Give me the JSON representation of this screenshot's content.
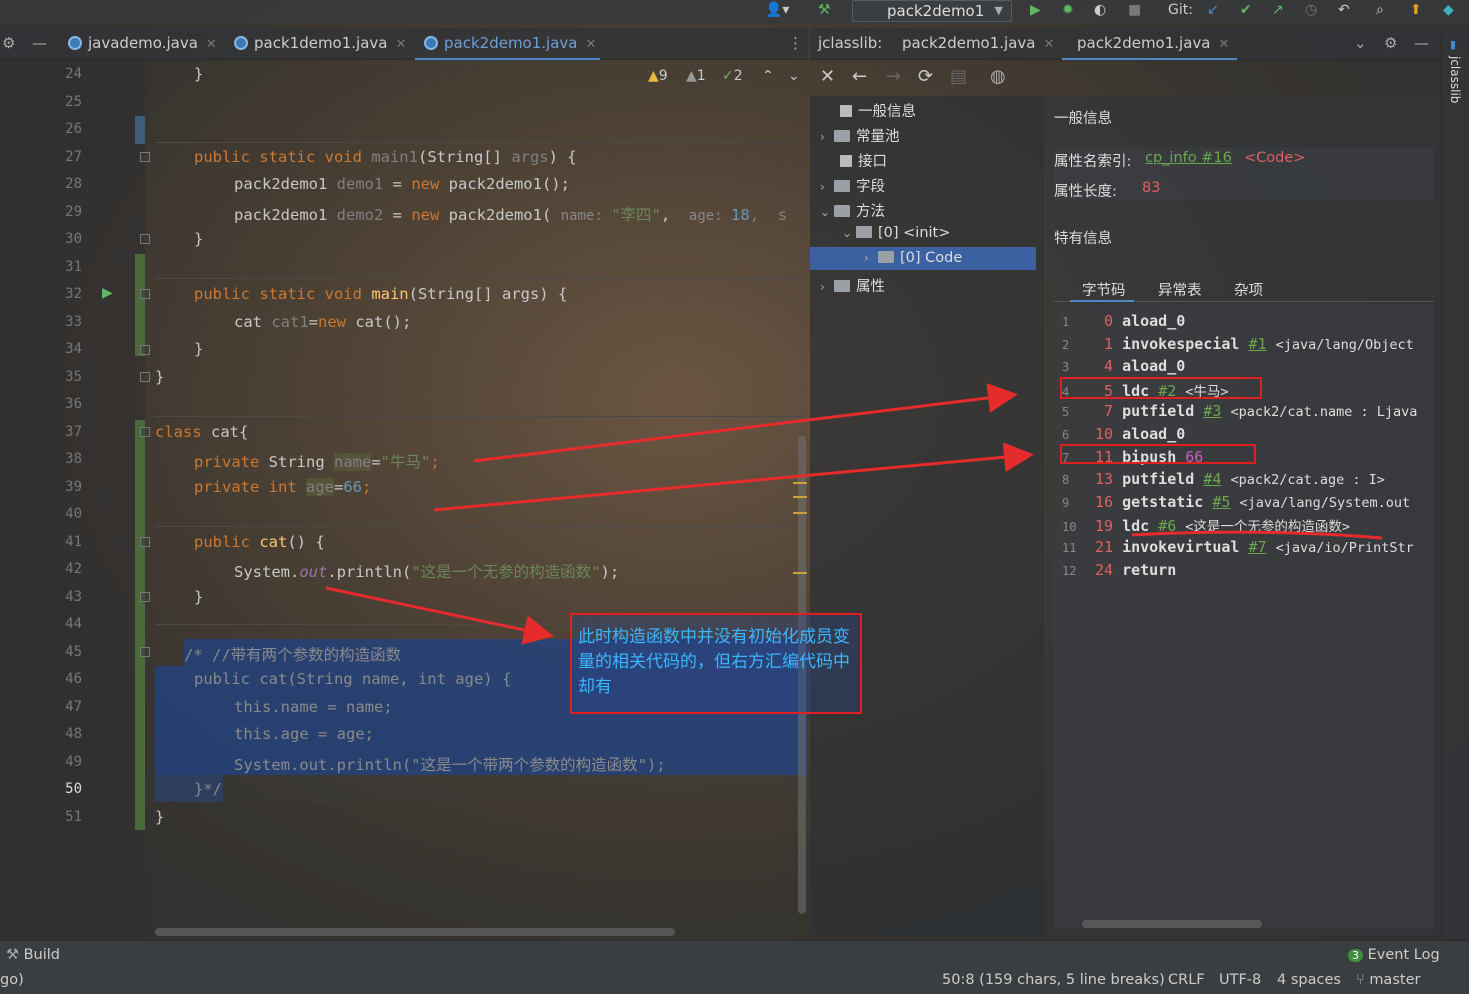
{
  "toolbar": {
    "project_selector": "pack2demo1",
    "git_label": "Git:"
  },
  "editor_tabs": [
    {
      "label": "javademo.java",
      "active": false
    },
    {
      "label": "pack1demo1.java",
      "active": false
    },
    {
      "label": "pack2demo1.java",
      "active": true
    }
  ],
  "inspections": {
    "warnings": "9",
    "weak_warnings": "1",
    "typos": "2"
  },
  "line_numbers": [
    "24",
    "25",
    "26",
    "27",
    "28",
    "29",
    "30",
    "31",
    "32",
    "33",
    "34",
    "35",
    "36",
    "37",
    "38",
    "39",
    "40",
    "41",
    "42",
    "43",
    "44",
    "45",
    "46",
    "47",
    "48",
    "49",
    "50",
    "51"
  ],
  "current_line": "50",
  "code": {
    "l24": "}",
    "l27_a": "public static void ",
    "l27_b": "main1",
    "l27_c": "(String[] ",
    "l27_d": "args",
    "l27_e": ") {",
    "l28_a": "pack2demo1 ",
    "l28_b": "demo1",
    "l28_c": " = ",
    "l28_d": "new ",
    "l28_e": "pack2demo1();",
    "l29_a": "pack2demo1 ",
    "l29_b": "demo2",
    "l29_c": " = ",
    "l29_d": "new ",
    "l29_e": "pack2demo1( ",
    "l29_f": "name: ",
    "l29_g": "\"李四\"",
    "l29_h": ",  ",
    "l29_i": "age: ",
    "l29_j": "18",
    "l29_k": ",  s",
    "l30": "}",
    "l32_a": "public static void ",
    "l32_b": "main",
    "l32_c": "(String[] args) {",
    "l33_a": "cat ",
    "l33_b": "cat1",
    "l33_c": "=",
    "l33_d": "new ",
    "l33_e": "cat();",
    "l34": "}",
    "l35": "}",
    "l37_a": "class ",
    "l37_b": "cat{",
    "l38_a": "private ",
    "l38_b": "String ",
    "l38_c": "name",
    "l38_d": "=",
    "l38_e": "\"牛马\"",
    "l38_f": ";",
    "l39_a": "private ",
    "l39_b": "int ",
    "l39_c": "age",
    "l39_d": "=",
    "l39_e": "66",
    "l39_f": ";",
    "l41_a": "public ",
    "l41_b": "cat",
    "l41_c": "() {",
    "l42_a": "System.",
    "l42_b": "out",
    "l42_c": ".println(",
    "l42_d": "\"这是一个无参的构造函数\"",
    "l42_e": ");",
    "l43": "}",
    "l45": "/* //带有两个参数的构造函数",
    "l46": "public cat(String name, int age) {",
    "l47": "this.name = name;",
    "l48": "this.age = age;",
    "l49": "System.out.println(\"这是一个带两个参数的构造函数\");",
    "l50": "}*/",
    "l51": "}"
  },
  "jclasslib": {
    "tabs": [
      {
        "label": "jclasslib:",
        "active": false
      },
      {
        "label": "pack2demo1.java",
        "active": false
      },
      {
        "label": "pack2demo1.java",
        "active": true
      }
    ],
    "tree": [
      {
        "label": "一般信息"
      },
      {
        "label": "常量池"
      },
      {
        "label": "接口"
      },
      {
        "label": "字段"
      },
      {
        "label": "方法"
      },
      {
        "label": "[0] <init>"
      },
      {
        "label": "[0] Code"
      },
      {
        "label": "属性"
      }
    ],
    "info_title": "一般信息",
    "attr_name_label": "属性名索引:",
    "attr_name_ref": "cp_info #16",
    "attr_name_value": "<Code>",
    "attr_len_label": "属性长度:",
    "attr_len_value": "83",
    "specific_title": "特有信息",
    "bytecode_tabs": [
      "字节码",
      "异常表",
      "杂项"
    ],
    "bytecode": [
      {
        "n": "1",
        "off": "0",
        "op": "aload_0",
        "ref": "",
        "arg": ""
      },
      {
        "n": "2",
        "off": "1",
        "op": "invokespecial",
        "ref": "#1",
        "arg": "<java/lang/Object"
      },
      {
        "n": "3",
        "off": "4",
        "op": "aload_0",
        "ref": "",
        "arg": ""
      },
      {
        "n": "4",
        "off": "5",
        "op": "ldc",
        "ref": "#2",
        "arg": "<牛马>"
      },
      {
        "n": "5",
        "off": "7",
        "op": "putfield",
        "ref": "#3",
        "arg": "<pack2/cat.name : Ljava"
      },
      {
        "n": "6",
        "off": "10",
        "op": "aload_0",
        "ref": "",
        "arg": ""
      },
      {
        "n": "7",
        "off": "11",
        "op": "bipush",
        "ref": "",
        "arg": "66"
      },
      {
        "n": "8",
        "off": "13",
        "op": "putfield",
        "ref": "#4",
        "arg": "<pack2/cat.age : I>"
      },
      {
        "n": "9",
        "off": "16",
        "op": "getstatic",
        "ref": "#5",
        "arg": "<java/lang/System.out"
      },
      {
        "n": "10",
        "off": "19",
        "op": "ldc",
        "ref": "#6",
        "arg": "<这是一个无参的构造函数>"
      },
      {
        "n": "11",
        "off": "21",
        "op": "invokevirtual",
        "ref": "#7",
        "arg": "<java/io/PrintStr"
      },
      {
        "n": "12",
        "off": "24",
        "op": "return",
        "ref": "",
        "arg": ""
      }
    ],
    "side_label": "jclasslib"
  },
  "annotation": "此时构造函数中并没有初始化成员变量的相关代码的，但右方汇编代码中却有",
  "bottom": {
    "build": "Build",
    "event_log": "Event Log",
    "event_count": "3",
    "left_status": "go)",
    "position": "50:8 (159 chars, 5 line breaks)",
    "line_sep": "CRLF",
    "encoding": "UTF-8",
    "indent": "4 spaces",
    "branch": "master"
  },
  "colors": {
    "accent": "#4a88c7",
    "annotation_red": "#e02020",
    "annotation_text": "#3ab7ff"
  }
}
